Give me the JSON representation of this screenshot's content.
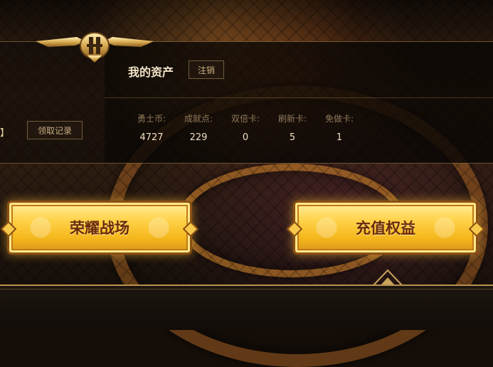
{
  "assets": {
    "title": "我的资产",
    "logout_label": "注销",
    "records_label": "领取记录",
    "bracket": "】",
    "stats": [
      {
        "label": "勇士币:",
        "value": "4727"
      },
      {
        "label": "成就点:",
        "value": "229"
      },
      {
        "label": "双倍卡:",
        "value": "0"
      },
      {
        "label": "刷新卡:",
        "value": "5"
      },
      {
        "label": "免做卡:",
        "value": "1"
      }
    ]
  },
  "buttons": {
    "honor_battlefield": "荣耀战场",
    "recharge_benefits": "充值权益"
  },
  "theme": {
    "gold": "#f5b81d",
    "brown_text": "#6b2a08",
    "panel_bg": "#0a0705"
  }
}
